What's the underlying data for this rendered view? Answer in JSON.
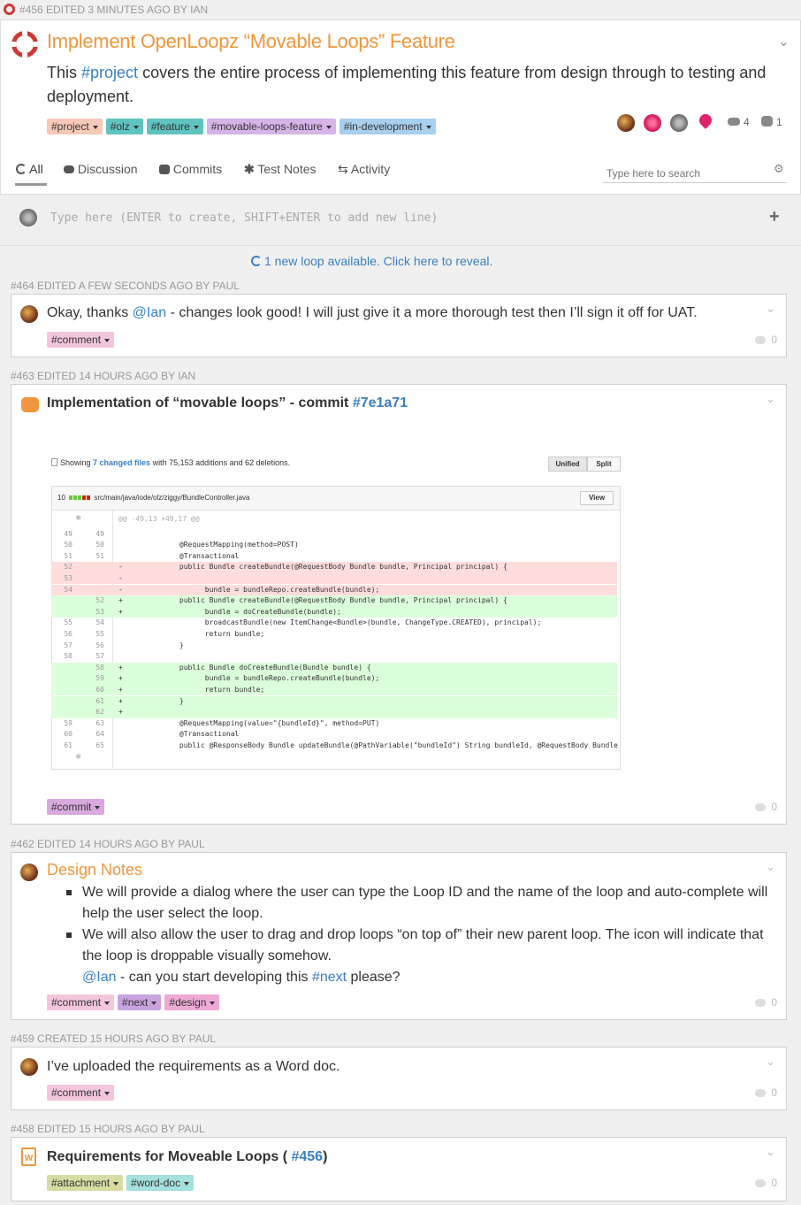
{
  "header": {
    "meta": "#456 EDITED 3 MINUTES AGO BY IAN",
    "title": "Implement OpenLoopz “Movable Loops” Feature",
    "desc_pre": "This ",
    "desc_link": "#project",
    "desc_post": " covers the entire process of implementing this feature from design through to testing and deployment.",
    "tags": [
      "#project",
      "#olz",
      "#feature",
      "#movable-loops-feature",
      "#in-development"
    ],
    "comment_count": "4",
    "fork_count": "1"
  },
  "tabs": [
    {
      "label": "All",
      "icon": "circle-icon"
    },
    {
      "label": "Discussion",
      "icon": "chat-icon"
    },
    {
      "label": "Commits",
      "icon": "github-icon"
    },
    {
      "label": "Test Notes",
      "icon": "asterisk-icon"
    },
    {
      "label": "Activity",
      "icon": "arrows-icon"
    }
  ],
  "search": {
    "placeholder": "Type here to search"
  },
  "composer": {
    "placeholder": "Type here (ENTER to create, SHIFT+ENTER to add new line)"
  },
  "new_loop_notice": "1 new loop available. Click here to reveal.",
  "loops": {
    "l464": {
      "meta": "#464 EDITED A FEW SECONDS AGO BY PAUL",
      "pre": "Okay, thanks ",
      "mention": "@Ian",
      "post": " - changes look good! I will just give it a more thorough test then I’ll sign it off for UAT.",
      "tag": "#comment",
      "count": "0"
    },
    "l463": {
      "meta": "#463 EDITED 14 HOURS AGO BY IAN",
      "title": "Implementation of “movable loops” - commit ",
      "commit": "#7e1a71",
      "tag": "#commit",
      "count": "0"
    },
    "l462": {
      "meta": "#462 EDITED 14 HOURS AGO BY PAUL",
      "title": "Design Notes",
      "bullet1": "We will provide a dialog where the user can type the Loop ID and the name of the loop and auto-complete will help the user select the loop.",
      "bullet2": "We will also allow the user to drag and drop loops “on top of” their new parent loop. The icon will indicate that the loop is droppable visually somehow.",
      "mention": "@Ian",
      "mid": " - can you start developing this ",
      "next_link": "#next",
      "end": " please?",
      "tags": [
        "#comment",
        "#next",
        "#design"
      ],
      "count": "0"
    },
    "l459": {
      "meta": "#459 CREATED 15 HOURS AGO BY PAUL",
      "text": "I’ve uploaded the requirements as a Word doc.",
      "tag": "#comment",
      "count": "0"
    },
    "l458": {
      "meta": "#458 EDITED 15 HOURS AGO BY PAUL",
      "title": "Requirements for Moveable Loops ( ",
      "ref": "#456",
      "title_end": ")",
      "tags": [
        "#attachment",
        "#word-doc"
      ],
      "count": "0"
    }
  },
  "diff": {
    "showing": "Showing ",
    "changed_files": "7 changed files",
    "stats": " with 75,153 additions and 62 deletions.",
    "unified": "Unified",
    "split": "Split",
    "file_count": "10",
    "file_path": "src/main/java/iode/olz/ziggy/BundleController.java",
    "view": "View",
    "hunk": "@@ -49,13 +49,17 @@",
    "lines": [
      {
        "o": "49",
        "n": "49",
        "s": "",
        "c": "",
        "t": "ctx"
      },
      {
        "o": "50",
        "n": "50",
        "s": "",
        "c": "      @RequestMapping(method=POST)",
        "t": "ctx"
      },
      {
        "o": "51",
        "n": "51",
        "s": "",
        "c": "      @Transactional",
        "t": "ctx"
      },
      {
        "o": "52",
        "n": "",
        "s": "-",
        "c": "      public Bundle createBundle(@RequestBody Bundle bundle, Principal principal) {",
        "t": "del"
      },
      {
        "o": "53",
        "n": "",
        "s": "-",
        "c": "",
        "t": "del"
      },
      {
        "o": "54",
        "n": "",
        "s": "-",
        "c": "            bundle = bundleRepo.createBundle(bundle);",
        "t": "del"
      },
      {
        "o": "",
        "n": "52",
        "s": "+",
        "c": "      public Bundle createBundle(@RequestBody Bundle bundle, Principal principal) {",
        "t": "add"
      },
      {
        "o": "",
        "n": "53",
        "s": "+",
        "c": "            bundle = doCreateBundle(bundle);",
        "t": "add"
      },
      {
        "o": "55",
        "n": "54",
        "s": "",
        "c": "            broadcastBundle(new ItemChange<Bundle>(bundle, ChangeType.CREATED), principal);",
        "t": "ctx"
      },
      {
        "o": "56",
        "n": "55",
        "s": "",
        "c": "            return bundle;",
        "t": "ctx"
      },
      {
        "o": "57",
        "n": "56",
        "s": "",
        "c": "      }",
        "t": "ctx"
      },
      {
        "o": "58",
        "n": "57",
        "s": "",
        "c": "",
        "t": "ctx"
      },
      {
        "o": "",
        "n": "58",
        "s": "+",
        "c": "      public Bundle doCreateBundle(Bundle bundle) {",
        "t": "add"
      },
      {
        "o": "",
        "n": "59",
        "s": "+",
        "c": "            bundle = bundleRepo.createBundle(bundle);",
        "t": "add"
      },
      {
        "o": "",
        "n": "60",
        "s": "+",
        "c": "            return bundle;",
        "t": "add"
      },
      {
        "o": "",
        "n": "61",
        "s": "+",
        "c": "      }",
        "t": "add"
      },
      {
        "o": "",
        "n": "62",
        "s": "+",
        "c": "",
        "t": "add"
      },
      {
        "o": "59",
        "n": "63",
        "s": "",
        "c": "      @RequestMapping(value=\"{bundleId}\", method=PUT)",
        "t": "ctx"
      },
      {
        "o": "60",
        "n": "64",
        "s": "",
        "c": "      @Transactional",
        "t": "ctx"
      },
      {
        "o": "61",
        "n": "65",
        "s": "",
        "c": "      public @ResponseBody Bundle updateBundle(@PathVariable(\"bundleId\") String bundleId, @RequestBody Bundle",
        "t": "ctx"
      }
    ]
  },
  "colors": {
    "accent": "#f0963c",
    "link": "#3a7fc1",
    "tag_project": "#f6c9b8",
    "tag_olz": "#5fc4c1",
    "tag_feature": "#5fc4c1",
    "tag_movable": "#d6b4e8",
    "tag_indev": "#a8cfee",
    "tag_comment": "#f3c6dc",
    "tag_next": "#c9a3e0",
    "tag_design": "#eeaad6",
    "tag_attachment": "#d6dca2",
    "tag_worddoc": "#a4e0dc",
    "diff_del": "#ffdddd",
    "diff_add": "#dbffdb"
  }
}
